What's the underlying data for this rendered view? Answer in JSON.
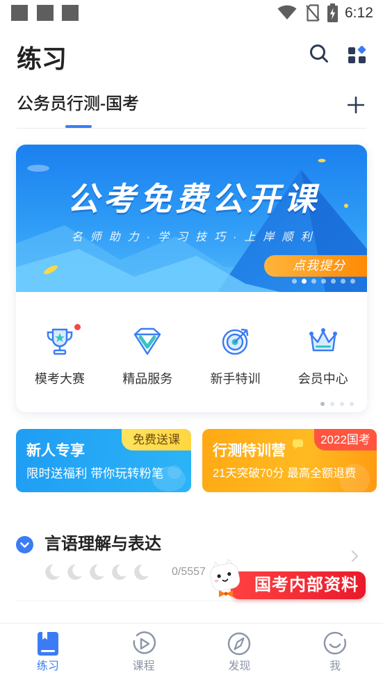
{
  "status_bar": {
    "time": "6:12",
    "left_icons": [
      "notification-square-icon",
      "notification-square-icon",
      "notification-square-icon"
    ],
    "right_icons": [
      "wifi-icon",
      "no-sim-icon",
      "battery-charging-icon"
    ]
  },
  "header": {
    "title": "练习",
    "search_icon": "search-icon",
    "apps_icon": "apps-icon"
  },
  "subject_tab": {
    "label": "公务员行测-国考",
    "add_icon": "plus-icon"
  },
  "banner": {
    "title": "公考免费公开课",
    "subtitle": "名师助力·学习技巧·上岸顺利",
    "cta": "点我提分",
    "slide_count": 7,
    "active_slide": 2
  },
  "quick_entries": {
    "items": [
      {
        "label": "模考大赛",
        "icon": "trophy-icon",
        "badge": true
      },
      {
        "label": "精品服务",
        "icon": "diamond-check-icon",
        "badge": false
      },
      {
        "label": "新手特训",
        "icon": "target-icon",
        "badge": false
      },
      {
        "label": "会员中心",
        "icon": "crown-icon",
        "badge": false
      }
    ],
    "page_count": 4,
    "active_page": 1
  },
  "promos": [
    {
      "title": "新人专享",
      "subtitle": "限时送福利 带你玩转粉笔",
      "tag": "免费送课"
    },
    {
      "title": "行测特训营",
      "subtitle": "21天突破70分 最高全额退费",
      "tag": "2022国考"
    }
  ],
  "practice_section": {
    "title": "言语理解与表达",
    "progress": "0/5557",
    "level_total": 5,
    "level_earned": 0,
    "expand_icon": "chevron-down-icon",
    "enter_icon": "chevron-right-icon"
  },
  "floating_ad": {
    "text": "国考内部资料",
    "mascot": "mascot-icon"
  },
  "bottom_nav": {
    "items": [
      {
        "label": "练习",
        "icon": "book-icon",
        "active": true
      },
      {
        "label": "课程",
        "icon": "play-circle-icon",
        "active": false
      },
      {
        "label": "发现",
        "icon": "compass-icon",
        "active": false
      },
      {
        "label": "我",
        "icon": "profile-smile-icon",
        "active": false
      }
    ]
  },
  "theme": {
    "accent": "#3b7cf5",
    "text": "#222222",
    "muted": "#8b95a6",
    "badge": "#f5474b"
  }
}
